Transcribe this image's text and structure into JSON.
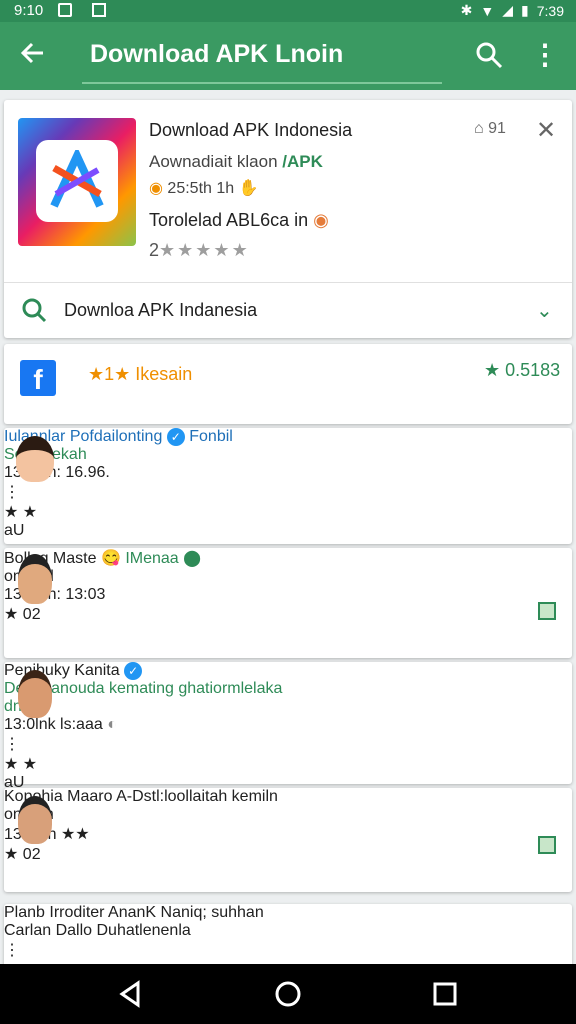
{
  "status_bar": {
    "time_left": "9:10",
    "time_right": "7:39"
  },
  "app_bar": {
    "title": "Download APK Lnoin",
    "back_icon": "arrow-left-icon",
    "search_icon": "search-icon",
    "menu_icon": "more-vert-icon"
  },
  "hero": {
    "app_name": "Download APK Indonesia",
    "subtitle_a": "Aownadiait klaon ",
    "subtitle_b": "/APK",
    "meta": "25:5th 1h",
    "developer": "Torolelad   ABL6ca in",
    "rating_prefix": "2",
    "stars": "★★★★★",
    "badge": "91",
    "close": "✕",
    "search_label": "Downloa APK Indanesia"
  },
  "facebook_card": {
    "label": "★1★ Ikesain",
    "score": "★ 0.5183"
  },
  "rows": [
    {
      "name": "Iulannlar Pofdailonting",
      "name2": "Fonbil",
      "sub": "Solnllaekah",
      "time": "13:0lnh: 16.96.",
      "rate_text": "★ ★",
      "pill": "aU"
    },
    {
      "name": "Bollag Maste",
      "name2": "IMenaa",
      "sub": "onoAbl",
      "time": "13:0lnh: 13:03",
      "rate_text": "★ 02",
      "pill": ""
    },
    {
      "name": "Penibuky Kanita",
      "name2": "",
      "sub": "Deaghanouda kemating ghatiormlelaka",
      "sub2": "dnids",
      "time": "13:0lnk ls:aaa",
      "rate_text": "★ ★",
      "pill": "aU"
    },
    {
      "name": "Kopohia Maaro A-Dstl:loollaitah kemiln",
      "name2": "",
      "sub": "onoAlh",
      "time": "13:0lnh ★★",
      "rate_text": "★ 02",
      "pill": ""
    },
    {
      "name": "Planb Irroditer AnanK Naniq; suhhan",
      "name2": "",
      "sub": "Carlan Dallo Duhatlenenla",
      "time": "",
      "rate_text": "",
      "pill": ""
    }
  ],
  "colors": {
    "primary": "#3a9a62",
    "status": "#2e8b57",
    "accent_green": "#2e8b57",
    "star_orange": "#ef8f00",
    "background": "#eceff0"
  }
}
